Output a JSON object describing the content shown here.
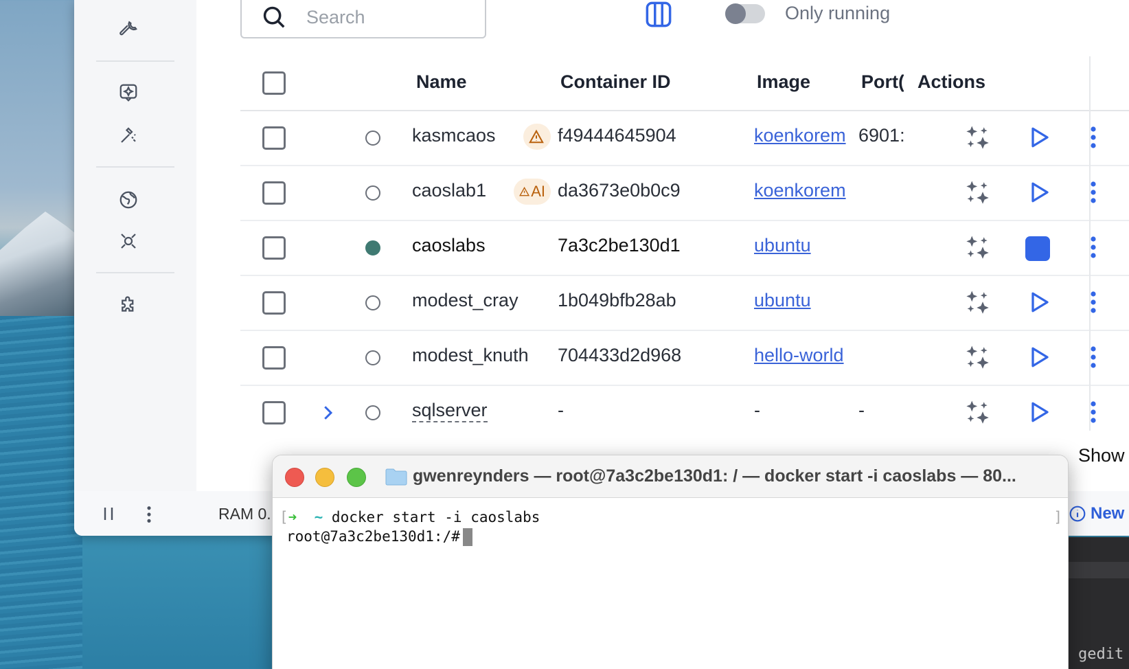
{
  "sidebar": {
    "icons": [
      "wrench-icon",
      "extension-gem-icon",
      "build-tools-icon",
      "globe-icon",
      "scout-icon",
      "puzzle-icon"
    ]
  },
  "toolbar": {
    "search_placeholder": "Search",
    "only_running_label": "Only running",
    "only_running_on": false
  },
  "table": {
    "headers": {
      "name": "Name",
      "container_id": "Container ID",
      "image": "Image",
      "ports": "Port(",
      "actions": "Actions"
    },
    "rows": [
      {
        "name": "kasmcaos",
        "warning": "",
        "container_id": "f49444645904",
        "image": "koenkorem",
        "ports": "6901:",
        "status": "stopped"
      },
      {
        "name": "caoslab1",
        "warning": "AI",
        "container_id": "da3673e0b0c9",
        "image": "koenkorem",
        "ports": "",
        "status": "stopped"
      },
      {
        "name": "caoslabs",
        "warning": "",
        "container_id": "7a3c2be130d1",
        "image": "ubuntu",
        "ports": "",
        "status": "running"
      },
      {
        "name": "modest_cray",
        "warning": "",
        "container_id": "1b049bfb28ab",
        "image": "ubuntu",
        "ports": "",
        "status": "stopped"
      },
      {
        "name": "modest_knuth",
        "warning": "",
        "container_id": "704433d2d968",
        "image": "hello-world",
        "ports": "",
        "status": "stopped"
      },
      {
        "name": "sqlserver",
        "warning": "",
        "container_id": "-",
        "image": "-",
        "ports": "-",
        "status": "stopped"
      }
    ]
  },
  "bottombar": {
    "ram": "RAM 0.",
    "show": "Show",
    "new": "New"
  },
  "terminal": {
    "title": "gwenreynders — root@7a3c2be130d1: / — docker start -i caoslabs — 80...",
    "line1_cmd": "docker start -i caoslabs",
    "line2_prompt": "root@7a3c2be130d1:/#"
  },
  "background_app": {
    "label": "gedit"
  },
  "colors": {
    "accent": "#3366e6",
    "running": "#3f7a72",
    "warning": "#b9610d"
  }
}
